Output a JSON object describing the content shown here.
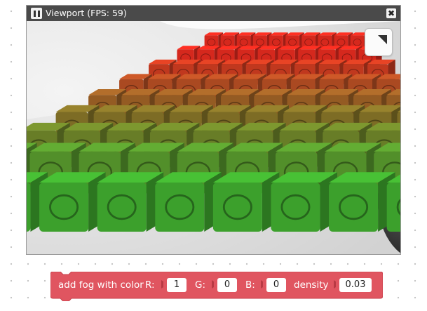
{
  "viewport": {
    "title": "Viewport (FPS: 59)",
    "pause_icon": "pause-icon",
    "close_icon": "close-icon",
    "close_glyph": "✖",
    "corner_icon": "expand-corner-icon",
    "scene_description_colors": {
      "front": "#3fa82e",
      "back": "#e02a1e",
      "background": "#ffffff"
    }
  },
  "block": {
    "label": "add fog with color",
    "r_label": "R:",
    "r_value": "1",
    "g_label": "G:",
    "g_value": "0",
    "b_label": "B:",
    "b_value": "0",
    "density_label": "density",
    "density_value": "0.03",
    "color": "#e05560"
  }
}
